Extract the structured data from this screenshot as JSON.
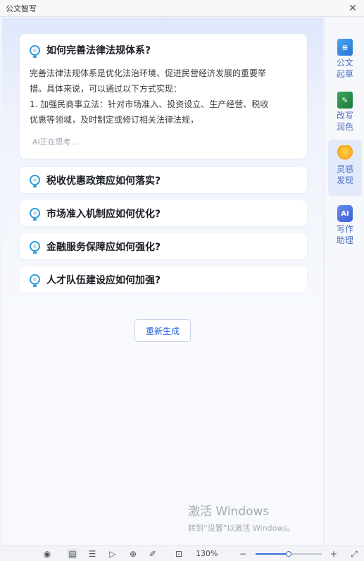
{
  "window": {
    "title": "公文智写",
    "close_icon": "close-icon"
  },
  "expanded_question": {
    "title": "如何完善法律法规体系?",
    "answer_lines": [
      "完善法律法规体系是优化法治环境、促进民营经济发展的重要举",
      "措。具体来说，可以通过以下方式实现：",
      "1. 加强民商事立法：针对市场准入、投资设立、生产经营、税收",
      "优惠等领域，及时制定或修订相关法律法规，"
    ],
    "status": "AI正在思考..."
  },
  "questions": [
    {
      "title": "税收优惠政策应如何落实?"
    },
    {
      "title": "市场准入机制应如何优化?"
    },
    {
      "title": "金融服务保障应如何强化?"
    },
    {
      "title": "人才队伍建设应如何加强?"
    }
  ],
  "regenerate_label": "重新生成",
  "sidebar": {
    "items": [
      {
        "label": "公文起草",
        "icon": "draft-document-icon",
        "active": false
      },
      {
        "label": "改写润色",
        "icon": "edit-pen-icon",
        "active": false
      },
      {
        "label": "灵感发现",
        "icon": "lightbulb-icon",
        "active": true
      },
      {
        "label": "写作助理",
        "icon": "ai-assistant-icon",
        "active": false
      }
    ]
  },
  "watermark": {
    "line1": "激活 Windows",
    "line2": "转到“设置”以激活 Windows。"
  },
  "statusbar": {
    "zoom_label": "130%",
    "zoom_level": 0.5,
    "icons": [
      "eye-icon",
      "page-view-icon",
      "outline-icon",
      "play-icon",
      "globe-icon",
      "pen-icon",
      "fit-page-icon",
      "zoom-out-icon",
      "zoom-in-icon",
      "fullscreen-icon"
    ]
  },
  "colors": {
    "accent": "#2864d8",
    "bulb": "#2f9bdb",
    "active_sidebar": "#e3ebfb"
  }
}
